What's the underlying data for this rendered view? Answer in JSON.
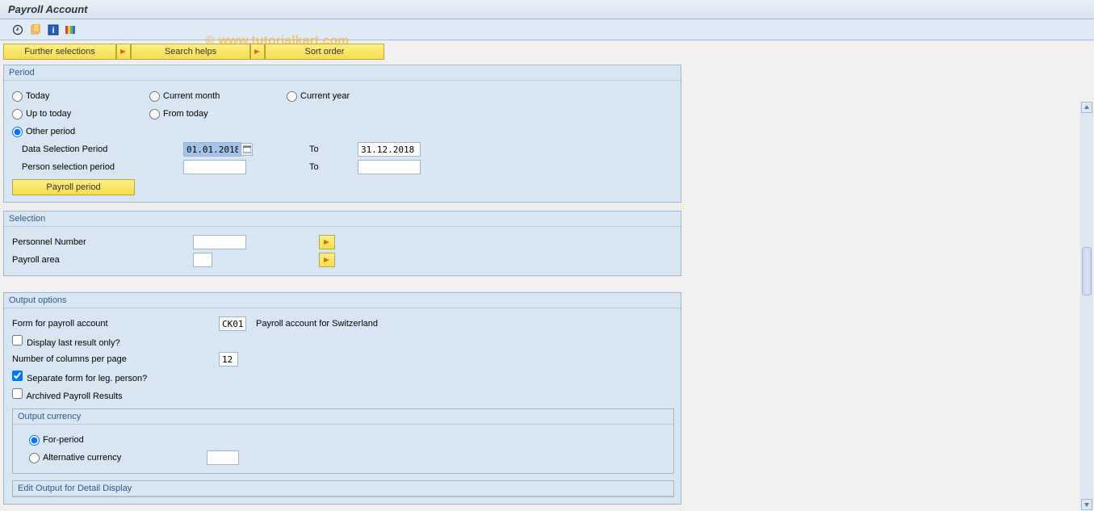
{
  "watermark": "© www.tutorialkart.com",
  "title": "Payroll Account",
  "topButtons": {
    "further": "Further selections",
    "search": "Search helps",
    "sort": "Sort order"
  },
  "period": {
    "title": "Period",
    "today": "Today",
    "currentMonth": "Current month",
    "currentYear": "Current year",
    "upToToday": "Up to today",
    "fromToday": "From today",
    "otherPeriod": "Other period",
    "dataSelPeriod": "Data Selection Period",
    "dataSelFrom": "01.01.2018",
    "dataSelTo": "31.12.2018",
    "personSelPeriod": "Person selection period",
    "to": "To",
    "payrollPeriod": "Payroll period"
  },
  "selection": {
    "title": "Selection",
    "personnelNumber": "Personnel Number",
    "payrollArea": "Payroll area"
  },
  "output": {
    "title": "Output options",
    "formLabel": "Form for payroll account",
    "formCode": "CK01",
    "formDesc": "Payroll account for Switzerland",
    "displayLast": "Display last result only?",
    "numCols": "Number of columns per page",
    "numColsVal": "12",
    "sepForm": "Separate form for leg. person?",
    "archived": "Archived Payroll Results",
    "currency": {
      "title": "Output currency",
      "forPeriod": "For-period",
      "altCurrency": "Alternative currency"
    },
    "editOutput": "Edit Output for Detail Display"
  }
}
